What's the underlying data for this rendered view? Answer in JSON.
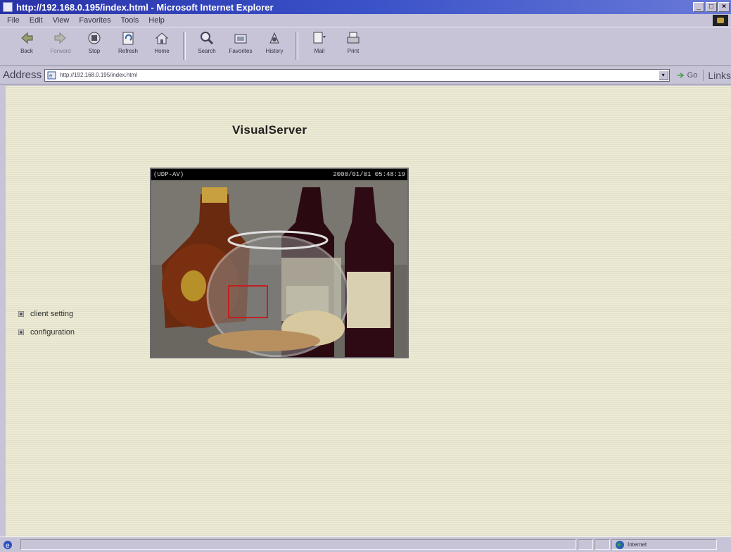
{
  "window": {
    "title": "http://192.168.0.195/index.html - Microsoft Internet Explorer"
  },
  "menu": [
    "File",
    "Edit",
    "View",
    "Favorites",
    "Tools",
    "Help"
  ],
  "toolbar": {
    "buttons": [
      {
        "label": "Back",
        "icon": "back-arrow-icon"
      },
      {
        "label": "Forward",
        "icon": "forward-arrow-icon"
      },
      {
        "label": "Stop",
        "icon": "stop-icon"
      },
      {
        "label": "Refresh",
        "icon": "refresh-icon"
      },
      {
        "label": "Home",
        "icon": "home-icon"
      },
      {
        "label": "Search",
        "icon": "search-icon"
      },
      {
        "label": "Favorites",
        "icon": "favorites-icon"
      },
      {
        "label": "History",
        "icon": "history-icon"
      },
      {
        "label": "Mail",
        "icon": "mail-icon"
      },
      {
        "label": "Print",
        "icon": "print-icon"
      }
    ]
  },
  "address": {
    "label": "Address",
    "url": "http://192.168.0.195/index.html",
    "go_label": "Go",
    "links_label": "Links"
  },
  "page": {
    "title": "VisualServer",
    "video": {
      "mode": "(UDP-AV)",
      "timestamp": "2000/01/01 05:48:19"
    },
    "links": [
      "client setting",
      "configuration"
    ]
  },
  "status": {
    "zone": "Internet"
  },
  "colors": {
    "titlebar": "#2a32a8",
    "chrome": "#c8c4d8",
    "page_bg": "#ece9d4"
  }
}
